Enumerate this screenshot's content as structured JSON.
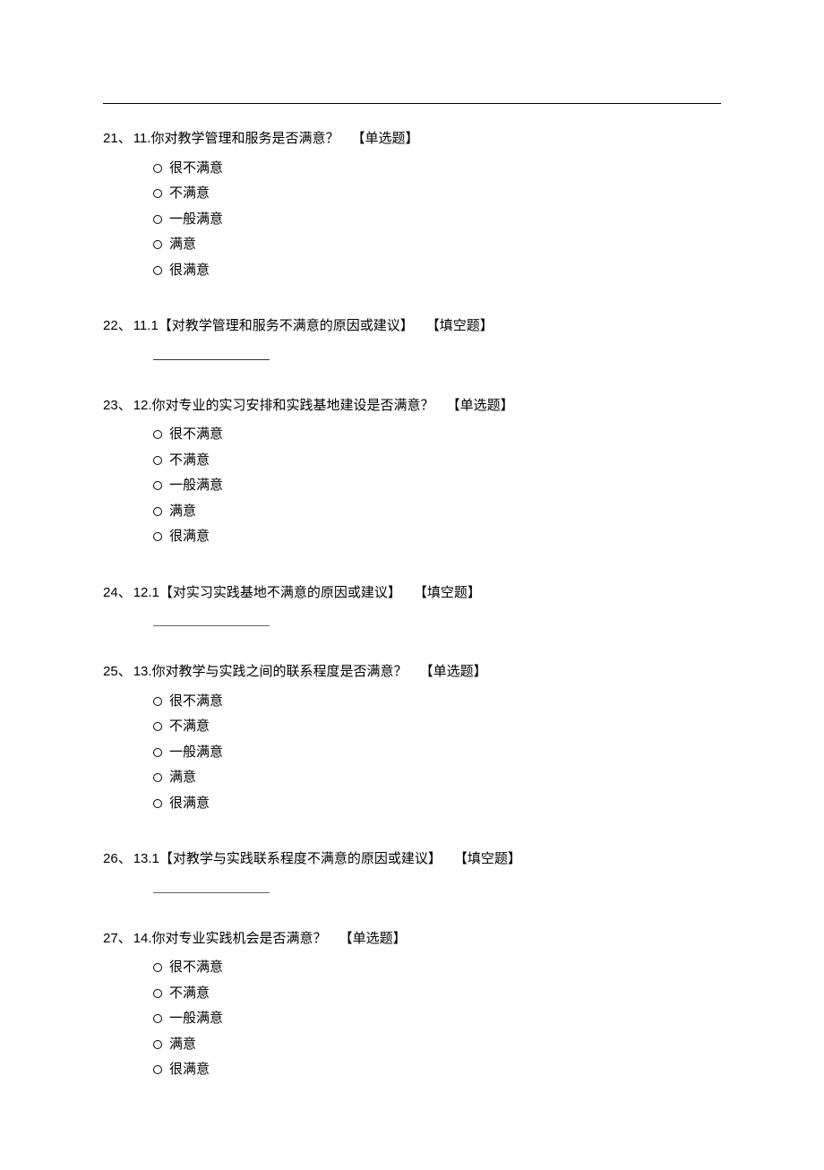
{
  "questions": [
    {
      "num": "21",
      "title": "11.你对教学管理和服务是否满意？",
      "tag": "【单选题】",
      "type": "choice",
      "options": [
        "很不满意",
        "不满意",
        "一般满意",
        "满意",
        "很满意"
      ]
    },
    {
      "num": "22",
      "title": "11.1【对教学管理和服务不满意的原因或建议】",
      "tag": "【填空题】",
      "type": "blank",
      "thin": false
    },
    {
      "num": "23",
      "title": "12.你对专业的实习安排和实践基地建设是否满意？",
      "tag": "【单选题】",
      "type": "choice",
      "options": [
        "很不满意",
        "不满意",
        "一般满意",
        "满意",
        "很满意"
      ]
    },
    {
      "num": "24",
      "title": "12.1【对实习实践基地不满意的原因或建议】",
      "tag": "【填空题】",
      "type": "blank",
      "thin": true
    },
    {
      "num": "25",
      "title": "13.你对教学与实践之间的联系程度是否满意？",
      "tag": "【单选题】",
      "type": "choice",
      "options": [
        "很不满意",
        "不满意",
        "一般满意",
        "满意",
        "很满意"
      ]
    },
    {
      "num": "26",
      "title": "13.1【对教学与实践联系程度不满意的原因或建议】",
      "tag": "【填空题】",
      "type": "blank",
      "thin": true
    },
    {
      "num": "27",
      "title": "14.你对专业实践机会是否满意？",
      "tag": "【单选题】",
      "type": "choice",
      "options": [
        "很不满意",
        "不满意",
        "一般满意",
        "满意",
        "很满意"
      ]
    }
  ],
  "separator": "、"
}
